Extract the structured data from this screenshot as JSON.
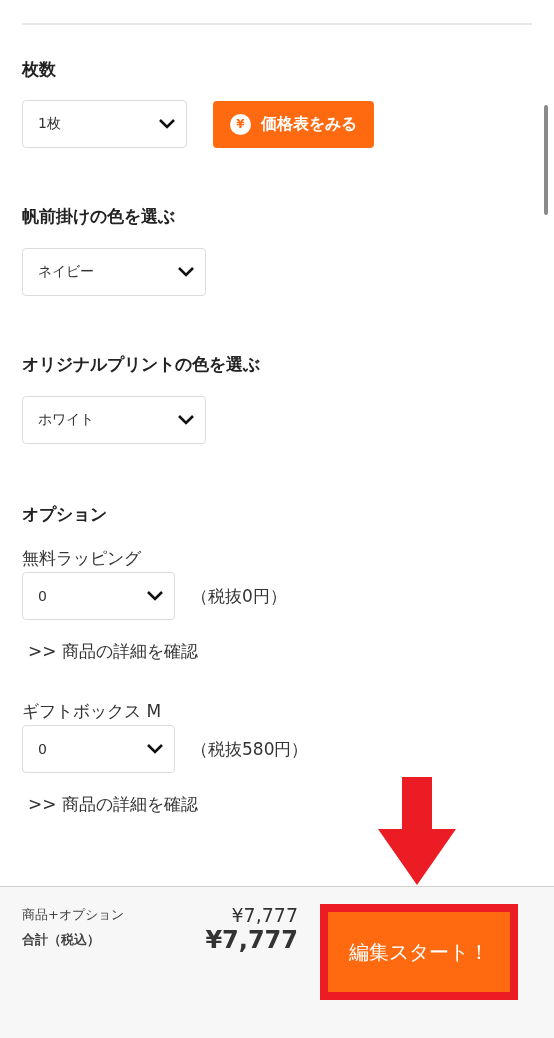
{
  "quantity": {
    "heading": "枚数",
    "value": "1枚",
    "price_button": {
      "icon": "¥",
      "label": "価格表をみる"
    }
  },
  "color_selects": [
    {
      "heading": "帆前掛けの色を選ぶ",
      "value": "ネイビー"
    },
    {
      "heading": "オリジナルプリントの色を選ぶ",
      "value": "ホワイト"
    }
  ],
  "options": {
    "heading": "オプション",
    "items": [
      {
        "name": "無料ラッピング",
        "value": "0",
        "price": "（税抜0円）",
        "link": ">> 商品の詳細を確認"
      },
      {
        "name": "ギフトボックス M",
        "value": "0",
        "price": "（税抜580円）",
        "link": ">> 商品の詳細を確認"
      }
    ]
  },
  "footer": {
    "subtotal_label": "商品+オプション",
    "subtotal": "¥7,777",
    "total_label": "合計（税込）",
    "total": "¥7,777",
    "start_button": "編集スタート！",
    "highlighted": true
  }
}
